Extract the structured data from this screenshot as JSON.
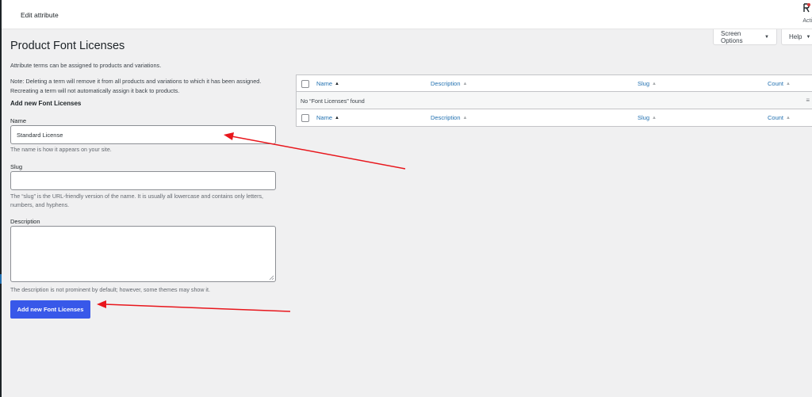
{
  "topbar": {
    "title": "Edit attribute",
    "activity_label": "Acti"
  },
  "screen_meta": {
    "screen_options": "Screen Options",
    "help": "Help"
  },
  "page": {
    "title": "Product Font Licenses",
    "intro": "Attribute terms can be assigned to products and variations.",
    "note": "Note: Deleting a term will remove it from all products and variations to which it has been assigned. Recreating a term will not automatically assign it back to products."
  },
  "form": {
    "heading": "Add new Font Licenses",
    "name": {
      "label": "Name",
      "value": "Standard License",
      "help": "The name is how it appears on your site."
    },
    "slug": {
      "label": "Slug",
      "value": "",
      "help": "The “slug” is the URL-friendly version of the name. It is usually all lowercase and contains only letters, numbers, and hyphens."
    },
    "description": {
      "label": "Description",
      "value": "",
      "help": "The description is not prominent by default; however, some themes may show it."
    },
    "submit_label": "Add new Font Licenses"
  },
  "table": {
    "columns": [
      "Name",
      "Description",
      "Slug",
      "Count"
    ],
    "empty_message": "No “Font Licenses” found"
  },
  "colors": {
    "primary_button": "#3858e9",
    "link": "#2271b1",
    "annotation_arrow": "#e8161c"
  }
}
